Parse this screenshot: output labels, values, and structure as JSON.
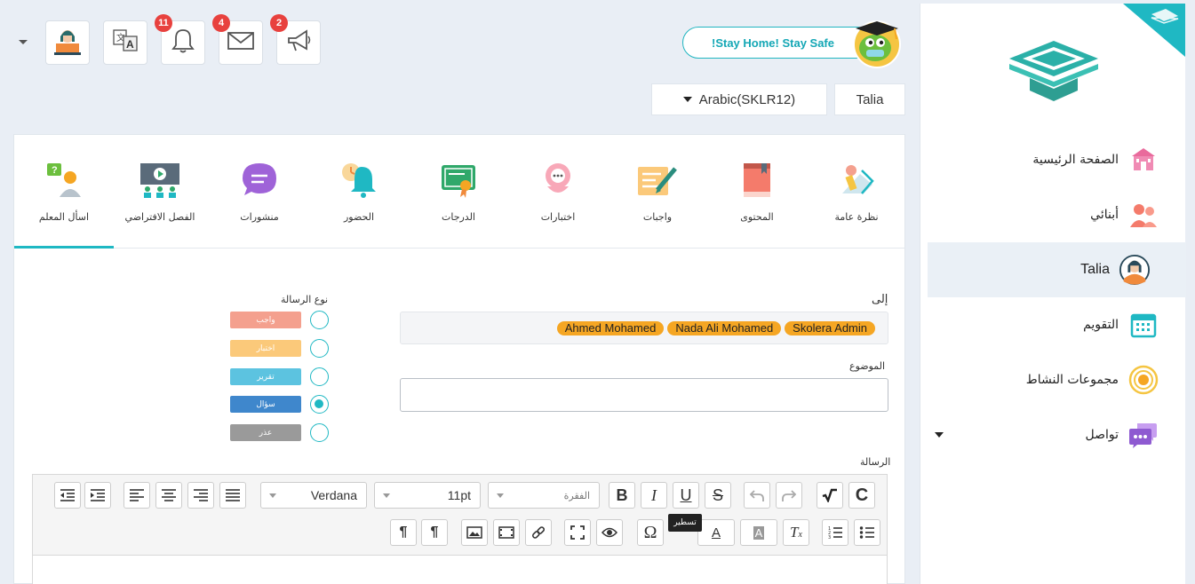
{
  "header": {
    "notifications": {
      "bell_count": "11",
      "mail_count": "4",
      "announce_count": "2"
    },
    "stay_home_text": "!Stay Home! Stay Safe",
    "student_name": "Talia",
    "course_selector": "Arabic(SKLR12)"
  },
  "sidebar": {
    "items": [
      {
        "label": "الصفحة الرئيسية",
        "icon": "school-icon"
      },
      {
        "label": "أبنائي",
        "icon": "children-icon"
      },
      {
        "label": "Talia",
        "icon": "student-avatar"
      },
      {
        "label": "التقويم",
        "icon": "calendar-icon"
      },
      {
        "label": "مجموعات النشاط",
        "icon": "activity-groups-icon"
      },
      {
        "label": "تواصل",
        "icon": "chat-icon"
      }
    ]
  },
  "tabs": [
    {
      "label": "نظرة عامة"
    },
    {
      "label": "المحتوى"
    },
    {
      "label": "واجبات"
    },
    {
      "label": "اختبارات"
    },
    {
      "label": "الدرجات"
    },
    {
      "label": "الحضور"
    },
    {
      "label": "منشورات"
    },
    {
      "label": "الفصل الافتراضي"
    },
    {
      "label": "اسأل المعلم"
    }
  ],
  "form": {
    "to_label": "إلى",
    "recipients": [
      "Skolera Admin",
      "Nada Ali Mohamed",
      "Ahmed Mohamed"
    ],
    "subject_label": "الموضوع",
    "subject_value": "",
    "message_type_label": "نوع الرسالة",
    "message_types": [
      {
        "label": "واجب",
        "color": "#f4a08e",
        "selected": false
      },
      {
        "label": "اختبار",
        "color": "#fbc97a",
        "selected": false
      },
      {
        "label": "تقرير",
        "color": "#5cc3e0",
        "selected": false
      },
      {
        "label": "سؤال",
        "color": "#3f87cc",
        "selected": true
      },
      {
        "label": "عذر",
        "color": "#9a9a9a",
        "selected": false
      }
    ],
    "message_label": "الرسالة"
  },
  "editor": {
    "font_family": "Verdana",
    "font_size": "11pt",
    "paragraph_format": "الفقرة",
    "tooltip": "تسطير"
  }
}
